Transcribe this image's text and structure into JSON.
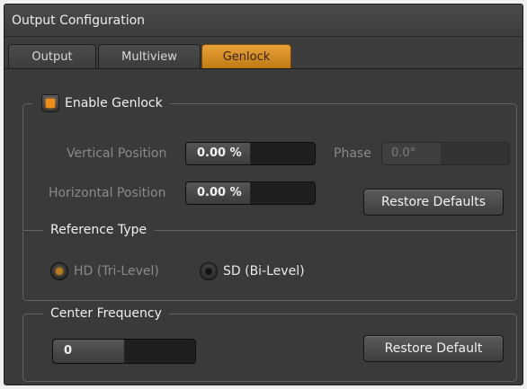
{
  "window": {
    "title": "Output Configuration"
  },
  "tabs": [
    {
      "label": "Output",
      "active": false
    },
    {
      "label": "Multiview",
      "active": false
    },
    {
      "label": "Genlock",
      "active": true
    }
  ],
  "genlock": {
    "enable_label": "Enable Genlock",
    "enabled": true,
    "vertical_position": {
      "label": "Vertical Position",
      "value": "0.00 %"
    },
    "horizontal_position": {
      "label": "Horizontal Position",
      "value": "0.00 %"
    },
    "phase": {
      "label": "Phase",
      "value": "0.0°"
    },
    "restore_defaults_label": "Restore Defaults",
    "reference_type": {
      "label": "Reference Type",
      "options": [
        {
          "label": "HD (Tri-Level)",
          "selected": true
        },
        {
          "label": "SD (Bi-Level)",
          "selected": false
        }
      ]
    }
  },
  "center_frequency": {
    "label": "Center Frequency",
    "value": "0",
    "restore_default_label": "Restore Default"
  },
  "colors": {
    "accent": "#f08c1a",
    "active_tab": "#d98e28",
    "panel_bg": "#3a3a3a"
  }
}
